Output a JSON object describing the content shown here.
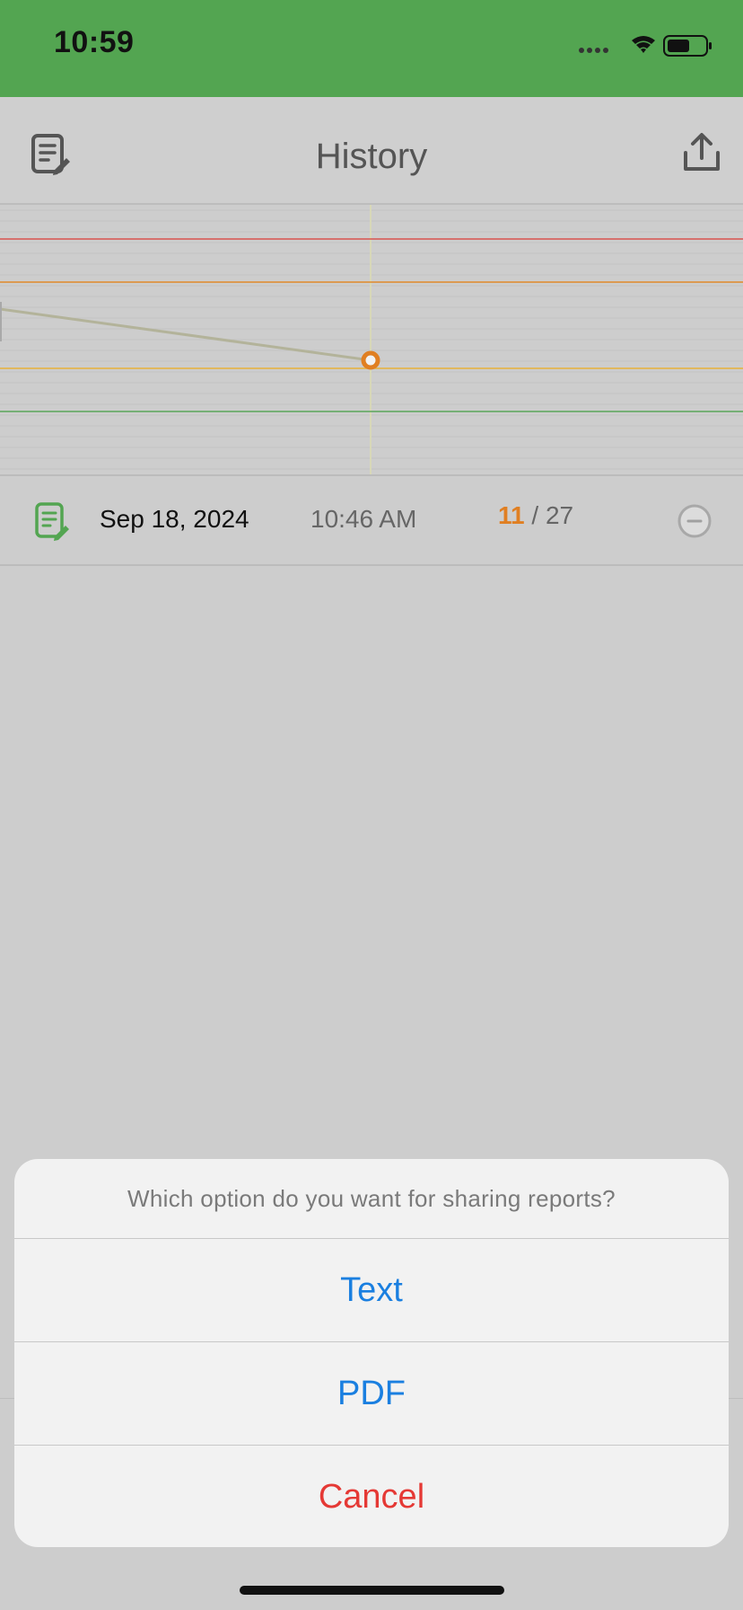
{
  "status_bar": {
    "time": "10:59",
    "icons": [
      "signal-icon",
      "wifi-icon",
      "battery-icon"
    ],
    "background": "#53a551"
  },
  "nav": {
    "title": "History",
    "left_icon": "notes-edit-icon",
    "right_icon": "share-icon"
  },
  "chart_data": {
    "type": "line",
    "title": "",
    "xlabel": "",
    "ylabel": "",
    "grid": true,
    "reference_line_colors": [
      "#d9534f",
      "#e08a2a",
      "#e8b23a",
      "#5aa55a"
    ],
    "series": [
      {
        "color": "#b3b39a",
        "marker_color": "#e07f22"
      }
    ]
  },
  "history": {
    "rows": [
      {
        "date": "Sep 18, 2024",
        "time": "10:46 AM",
        "score": "11",
        "total": "/ 27",
        "icon": "notes-edit-icon",
        "remove_icon": "minus-circle-icon"
      }
    ]
  },
  "share_sheet": {
    "title": "Which option do you want for sharing reports?",
    "options": [
      "Text",
      "PDF"
    ],
    "cancel": "Cancel"
  },
  "colors": {
    "accent": "#1a7fe0",
    "destructive": "#e53935",
    "score": "#e07f22"
  }
}
